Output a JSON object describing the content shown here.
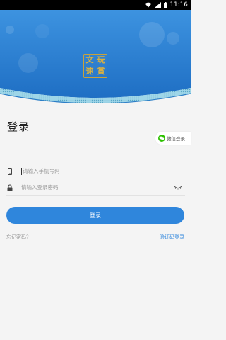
{
  "status_bar": {
    "time": "11:16",
    "icons": [
      "wifi-icon",
      "signal-icon",
      "battery-icon"
    ]
  },
  "header": {
    "logo": {
      "chars": [
        "文",
        "玩",
        "速",
        "賞"
      ]
    },
    "accent_color": "#2f86dc"
  },
  "page": {
    "title": "登录",
    "wechat_login_label": "微信登录"
  },
  "form": {
    "phone": {
      "icon": "phone-icon",
      "placeholder": "请输入手机号码",
      "value": ""
    },
    "password": {
      "icon": "lock-icon",
      "placeholder": "请输入登录密码",
      "value": "",
      "toggle_icon": "eye-closed-icon"
    },
    "submit_label": "登录",
    "forgot_label": "忘记密码？",
    "sms_login_label": "验证码登录"
  },
  "colors": {
    "primary": "#2f86dc",
    "background": "#f4f4f4",
    "logo_gold": "#d8b043",
    "wechat_green": "#2dc100"
  }
}
